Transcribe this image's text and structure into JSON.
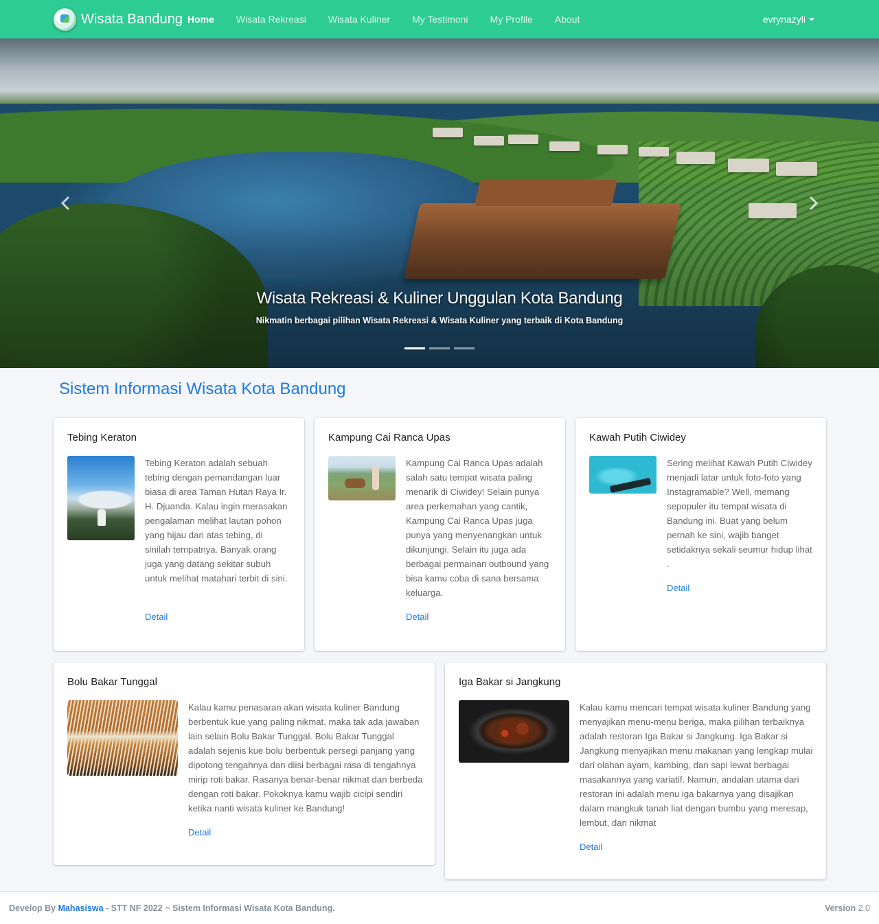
{
  "navbar": {
    "brand": "Wisata Bandung",
    "links": [
      {
        "label": "Home",
        "active": true
      },
      {
        "label": "Wisata Rekreasi"
      },
      {
        "label": "Wisata Kuliner"
      },
      {
        "label": "My Testimoni"
      },
      {
        "label": "My Profile"
      },
      {
        "label": "About"
      }
    ],
    "user": "evrynazyli",
    "color": "#2ecc95"
  },
  "hero": {
    "title": "Wisata Rekreasi & Kuliner Unggulan Kota Bandung",
    "subtitle": "Nikmatin berbagai pilihan Wisata Rekreasi & Wisata Kuliner yang terbaik di Kota Bandung",
    "prev_icon": "chevron-left-icon",
    "next_icon": "chevron-right-icon",
    "indicator_count": 3,
    "active_indicator": 1
  },
  "main": {
    "heading": "Sistem Informasi Wisata Kota Bandung",
    "accent": "#1f7ae0",
    "cards": [
      {
        "title": "Tebing Keraton",
        "text": "Tebing Keraton adalah sebuah tebing dengan pemandangan luar biasa di area Taman Hutan Raya Ir. H. Djuanda. Kalau ingin merasakan pengalaman melihat lautan pohon yang hijau dari atas tebing, di sinilah tempatnya. Banyak orang juga yang datang sekitar subuh untuk melihat matahari terbit di sini.",
        "link": "Detail"
      },
      {
        "title": "Kampung Cai Ranca Upas",
        "text": "Kampung Cai Ranca Upas adalah salah satu tempat wisata paling menarik di Ciwidey! Selain punya area perkemahan yang cantik, Kampung Cai Ranca Upas juga punya yang menyenangkan untuk dikunjungi. Selain itu juga ada berbagai permainan outbound yang bisa kamu coba di sana bersama keluarga.",
        "link": "Detail"
      },
      {
        "title": "Kawah Putih Ciwidey",
        "text": "Sering melihat Kawah Putih Ciwidey menjadi latar untuk foto-foto yang Instagramable? Well, memang sepopuler itu tempat wisata di Bandung ini. Buat yang belum pernah ke sini, wajib banget setidaknya sekali seumur hidup lihat .",
        "link": "Detail"
      },
      {
        "title": "Bolu Bakar Tunggal",
        "text": "Kalau kamu penasaran akan wisata kuliner Bandung berbentuk kue yang paling nikmat, maka tak ada jawaban lain selain Bolu Bakar Tunggal. Bolu Bakar Tunggal adalah sejenis kue bolu berbentuk persegi panjang yang dipotong tengahnya dan diisi berbagai rasa di tengahnya mirip roti bakar. Rasanya benar-benar nikmat dan berbeda dengan roti bakar. Pokoknya kamu wajib cicipi sendiri ketika nanti wisata kuliner ke Bandung!",
        "link": "Detail"
      },
      {
        "title": "Iga Bakar si Jangkung",
        "text": "Kalau kamu mencari tempat wisata kuliner Bandung yang menyajikan menu-menu beriga, maka pilihan terbaiknya adalah restoran Iga Bakar si Jangkung. Iga Bakar si Jangkung menyajikan menu makanan yang lengkap mulai dari olahan ayam, kambing, dan sapi lewat berbagai masakannya yang variatif. Namun, andalan utama dari restoran ini adalah menu iga bakarnya yang disajikan dalam mangkuk tanah liat dengan bumbu yang meresap, lembut, dan nikmat",
        "link": "Detail"
      }
    ]
  },
  "footer": {
    "prefix": "Develop By ",
    "author": "Mahasiswa",
    "suffix": " - STT NF 2022 ~ Sistem Informasi Wisata Kota Bandung.",
    "version_label": "Version",
    "version": "2.0"
  }
}
